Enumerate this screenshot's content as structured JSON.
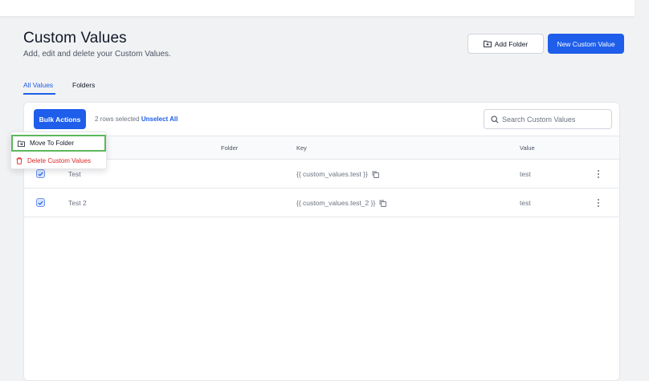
{
  "header": {
    "title": "Custom Values",
    "subtitle": "Add, edit and delete your Custom Values.",
    "add_folder_label": "Add Folder",
    "new_custom_value_label": "New Custom Value"
  },
  "tabs": {
    "all_values": "All Values",
    "folders": "Folders",
    "active": "All Values"
  },
  "toolbar": {
    "bulk_actions_label": "Bulk Actions",
    "rows_selected_text": "2 rows selected",
    "unselect_all_label": "Unselect All",
    "search_placeholder": "Search Custom Values"
  },
  "bulk_menu": {
    "move_to_folder": "Move To Folder",
    "delete_custom_values": "Delete Custom Values"
  },
  "table": {
    "columns": [
      "Folder",
      "Key",
      "Value"
    ],
    "rows": [
      {
        "name": "Test",
        "folder": "",
        "key": "{{ custom_values.test }}",
        "value": "test",
        "checked": true
      },
      {
        "name": "Test 2",
        "folder": "",
        "key": "{{ custom_values.test_2 }}",
        "value": "test",
        "checked": true
      }
    ]
  },
  "colors": {
    "accent": "#1e5eea",
    "danger": "#dc2626",
    "highlight": "#5cb85c"
  }
}
